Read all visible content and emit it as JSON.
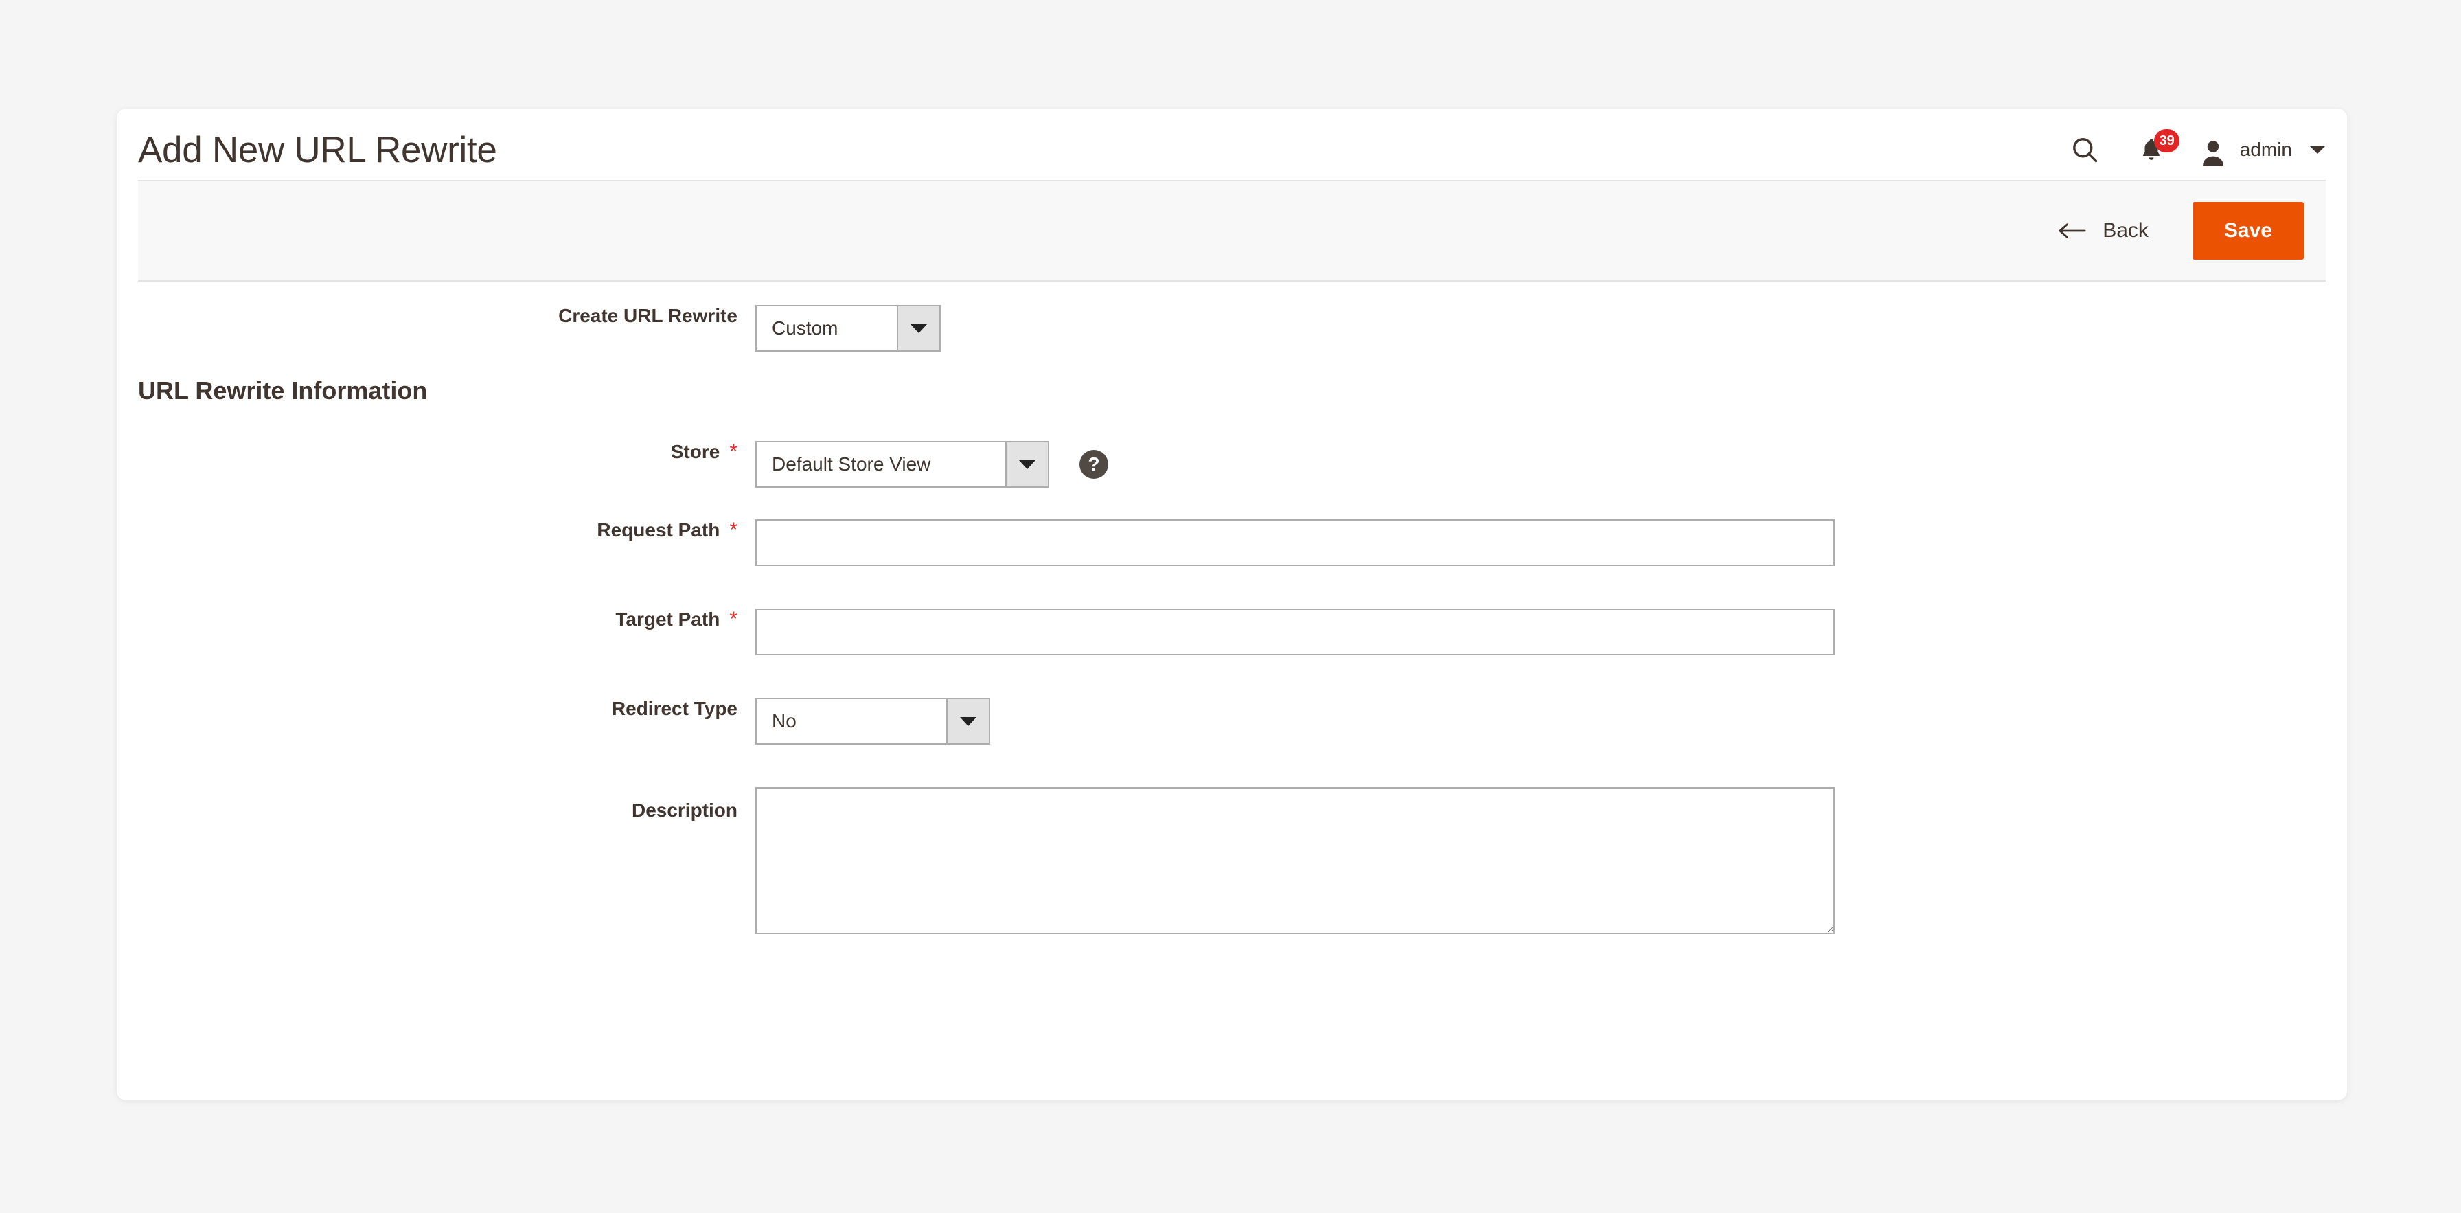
{
  "header": {
    "title": "Add New URL Rewrite",
    "search_icon": "search-icon",
    "notifications_icon": "bell-icon",
    "notifications_count": "39",
    "avatar_icon": "user-avatar-icon",
    "user_name": "admin",
    "user_menu_caret": "chevron-down-icon"
  },
  "toolbar": {
    "back_label": "Back",
    "back_icon": "arrow-left-icon",
    "save_label": "Save",
    "save_color": "#eb5202"
  },
  "form": {
    "create_rewrite": {
      "label": "Create URL Rewrite",
      "value": "Custom"
    },
    "section_title": "URL Rewrite Information",
    "store": {
      "label": "Store",
      "required": "*",
      "value": "Default Store View",
      "help_icon": "question-mark-icon"
    },
    "request_path": {
      "label": "Request Path",
      "required": "*",
      "value": "",
      "placeholder": ""
    },
    "target_path": {
      "label": "Target Path",
      "required": "*",
      "value": "",
      "placeholder": ""
    },
    "redirect_type": {
      "label": "Redirect Type",
      "value": "No"
    },
    "description": {
      "label": "Description",
      "value": "",
      "placeholder": ""
    }
  },
  "colors": {
    "page_background": "#f5f5f5",
    "card_background": "#ffffff",
    "toolbar_background": "#f8f8f8",
    "accent_orange": "#eb5202",
    "badge_red": "#e22626",
    "required_red": "#e02b27",
    "text_dark": "#41362f"
  }
}
